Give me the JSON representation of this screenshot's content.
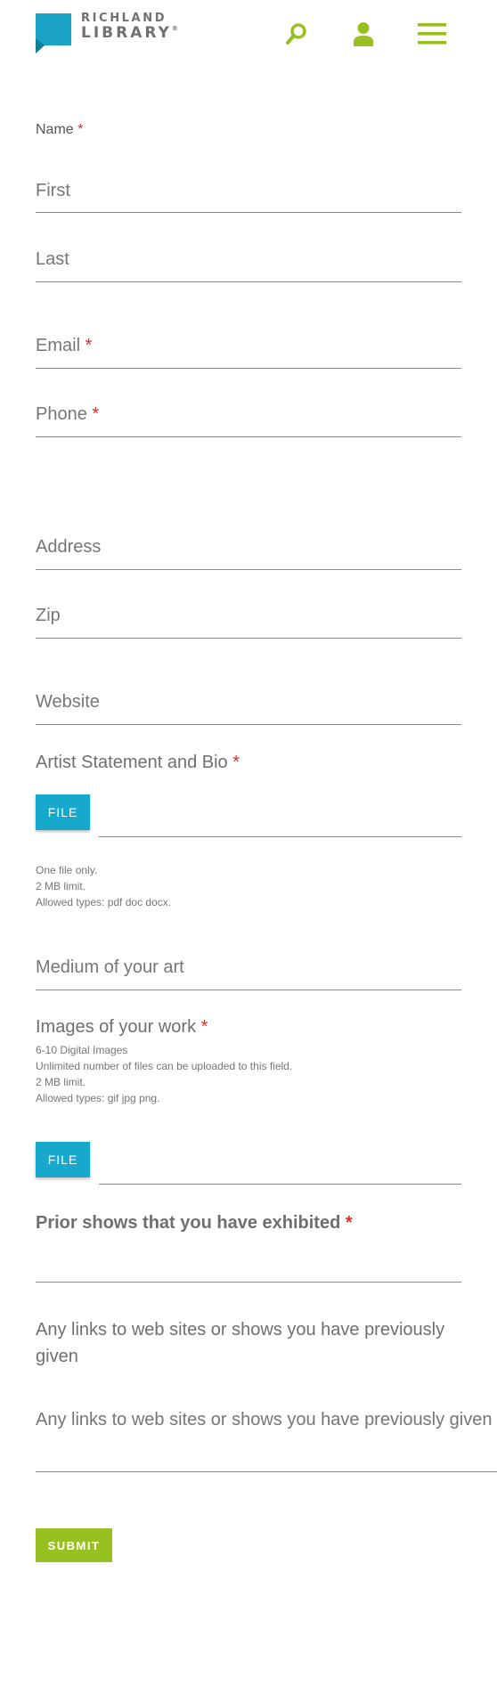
{
  "header": {
    "logo_line1": "RICHLAND",
    "logo_line2": "LIBRARY",
    "logo_reg": "®",
    "icons": [
      "search-icon",
      "user-icon",
      "menu-icon"
    ],
    "accent_color": "#97c121",
    "logo_color": "#1aa3c4"
  },
  "form": {
    "name_label": "Name",
    "required_mark": "*",
    "first_placeholder": "First",
    "last_placeholder": "Last",
    "email_placeholder": "Email",
    "phone_placeholder": "Phone",
    "address_placeholder": "Address",
    "zip_placeholder": "Zip",
    "website_placeholder": "Website",
    "artist_statement_label": "Artist Statement and Bio",
    "file_button_label": "FILE",
    "artist_statement_help": [
      "One file only.",
      "2 MB limit.",
      "Allowed types: pdf doc docx."
    ],
    "medium_placeholder": "Medium of your art",
    "images_label": "Images of your work",
    "images_help": [
      "6-10 Digital Images",
      "Unlimited number of files can be uploaded to this field.",
      "2 MB limit.",
      "Allowed types: gif jpg png."
    ],
    "prior_shows_label": "Prior shows that you have exhibited",
    "links_label_line1": "Any links to web sites or shows you have previously",
    "links_label_line2": "given",
    "links_placeholder": "Any links to web sites or shows you have previously given",
    "submit_label": "SUBMIT",
    "button_color": "#17a9cc",
    "required_color": "#e32b2b"
  }
}
